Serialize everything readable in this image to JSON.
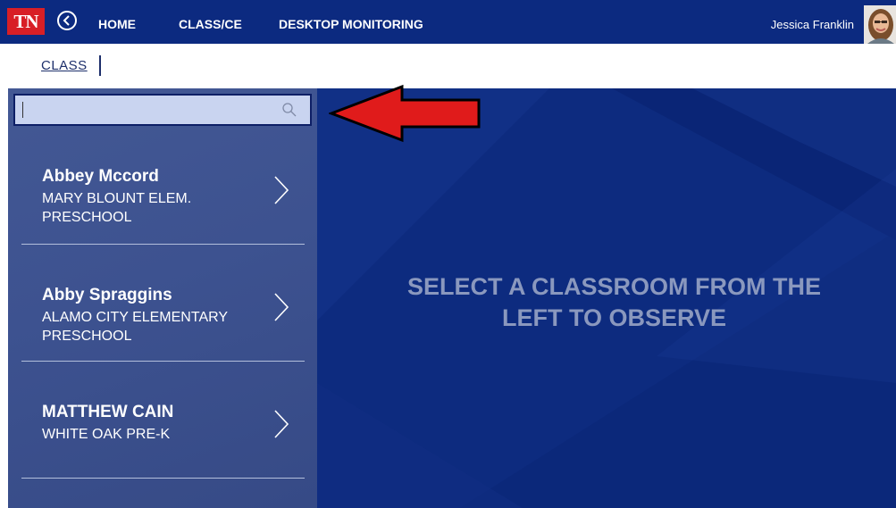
{
  "app": {
    "logo_text": "TN",
    "nav": {
      "home": "HOME",
      "class_ce": "CLASS/CE",
      "desktop_monitoring": "DESKTOP MONITORING"
    },
    "user": {
      "name": "Jessica Franklin"
    }
  },
  "breadcrumb": {
    "current": "CLASS"
  },
  "search": {
    "value": "",
    "placeholder": "",
    "icon": "search-icon"
  },
  "classrooms": [
    {
      "name": "Abbey Mccord",
      "school_line1": "MARY BLOUNT ELEM.",
      "school_line2": "PRESCHOOL"
    },
    {
      "name": "Abby Spraggins",
      "school_line1": "ALAMO CITY ELEMENTARY",
      "school_line2": "PRESCHOOL"
    },
    {
      "name": "MATTHEW CAIN",
      "school_line1": "WHITE OAK PRE-K",
      "school_line2": ""
    }
  ],
  "main": {
    "prompt_line1": "SELECT A CLASSROOM FROM THE",
    "prompt_line2": "LEFT TO OBSERVE"
  },
  "colors": {
    "nav_bg": "#0c2a80",
    "logo_red": "#d81f26",
    "sidebar_bg": "#3d5290",
    "main_bg": "#0d2b7f",
    "annotation_arrow": "#e01b1b"
  }
}
